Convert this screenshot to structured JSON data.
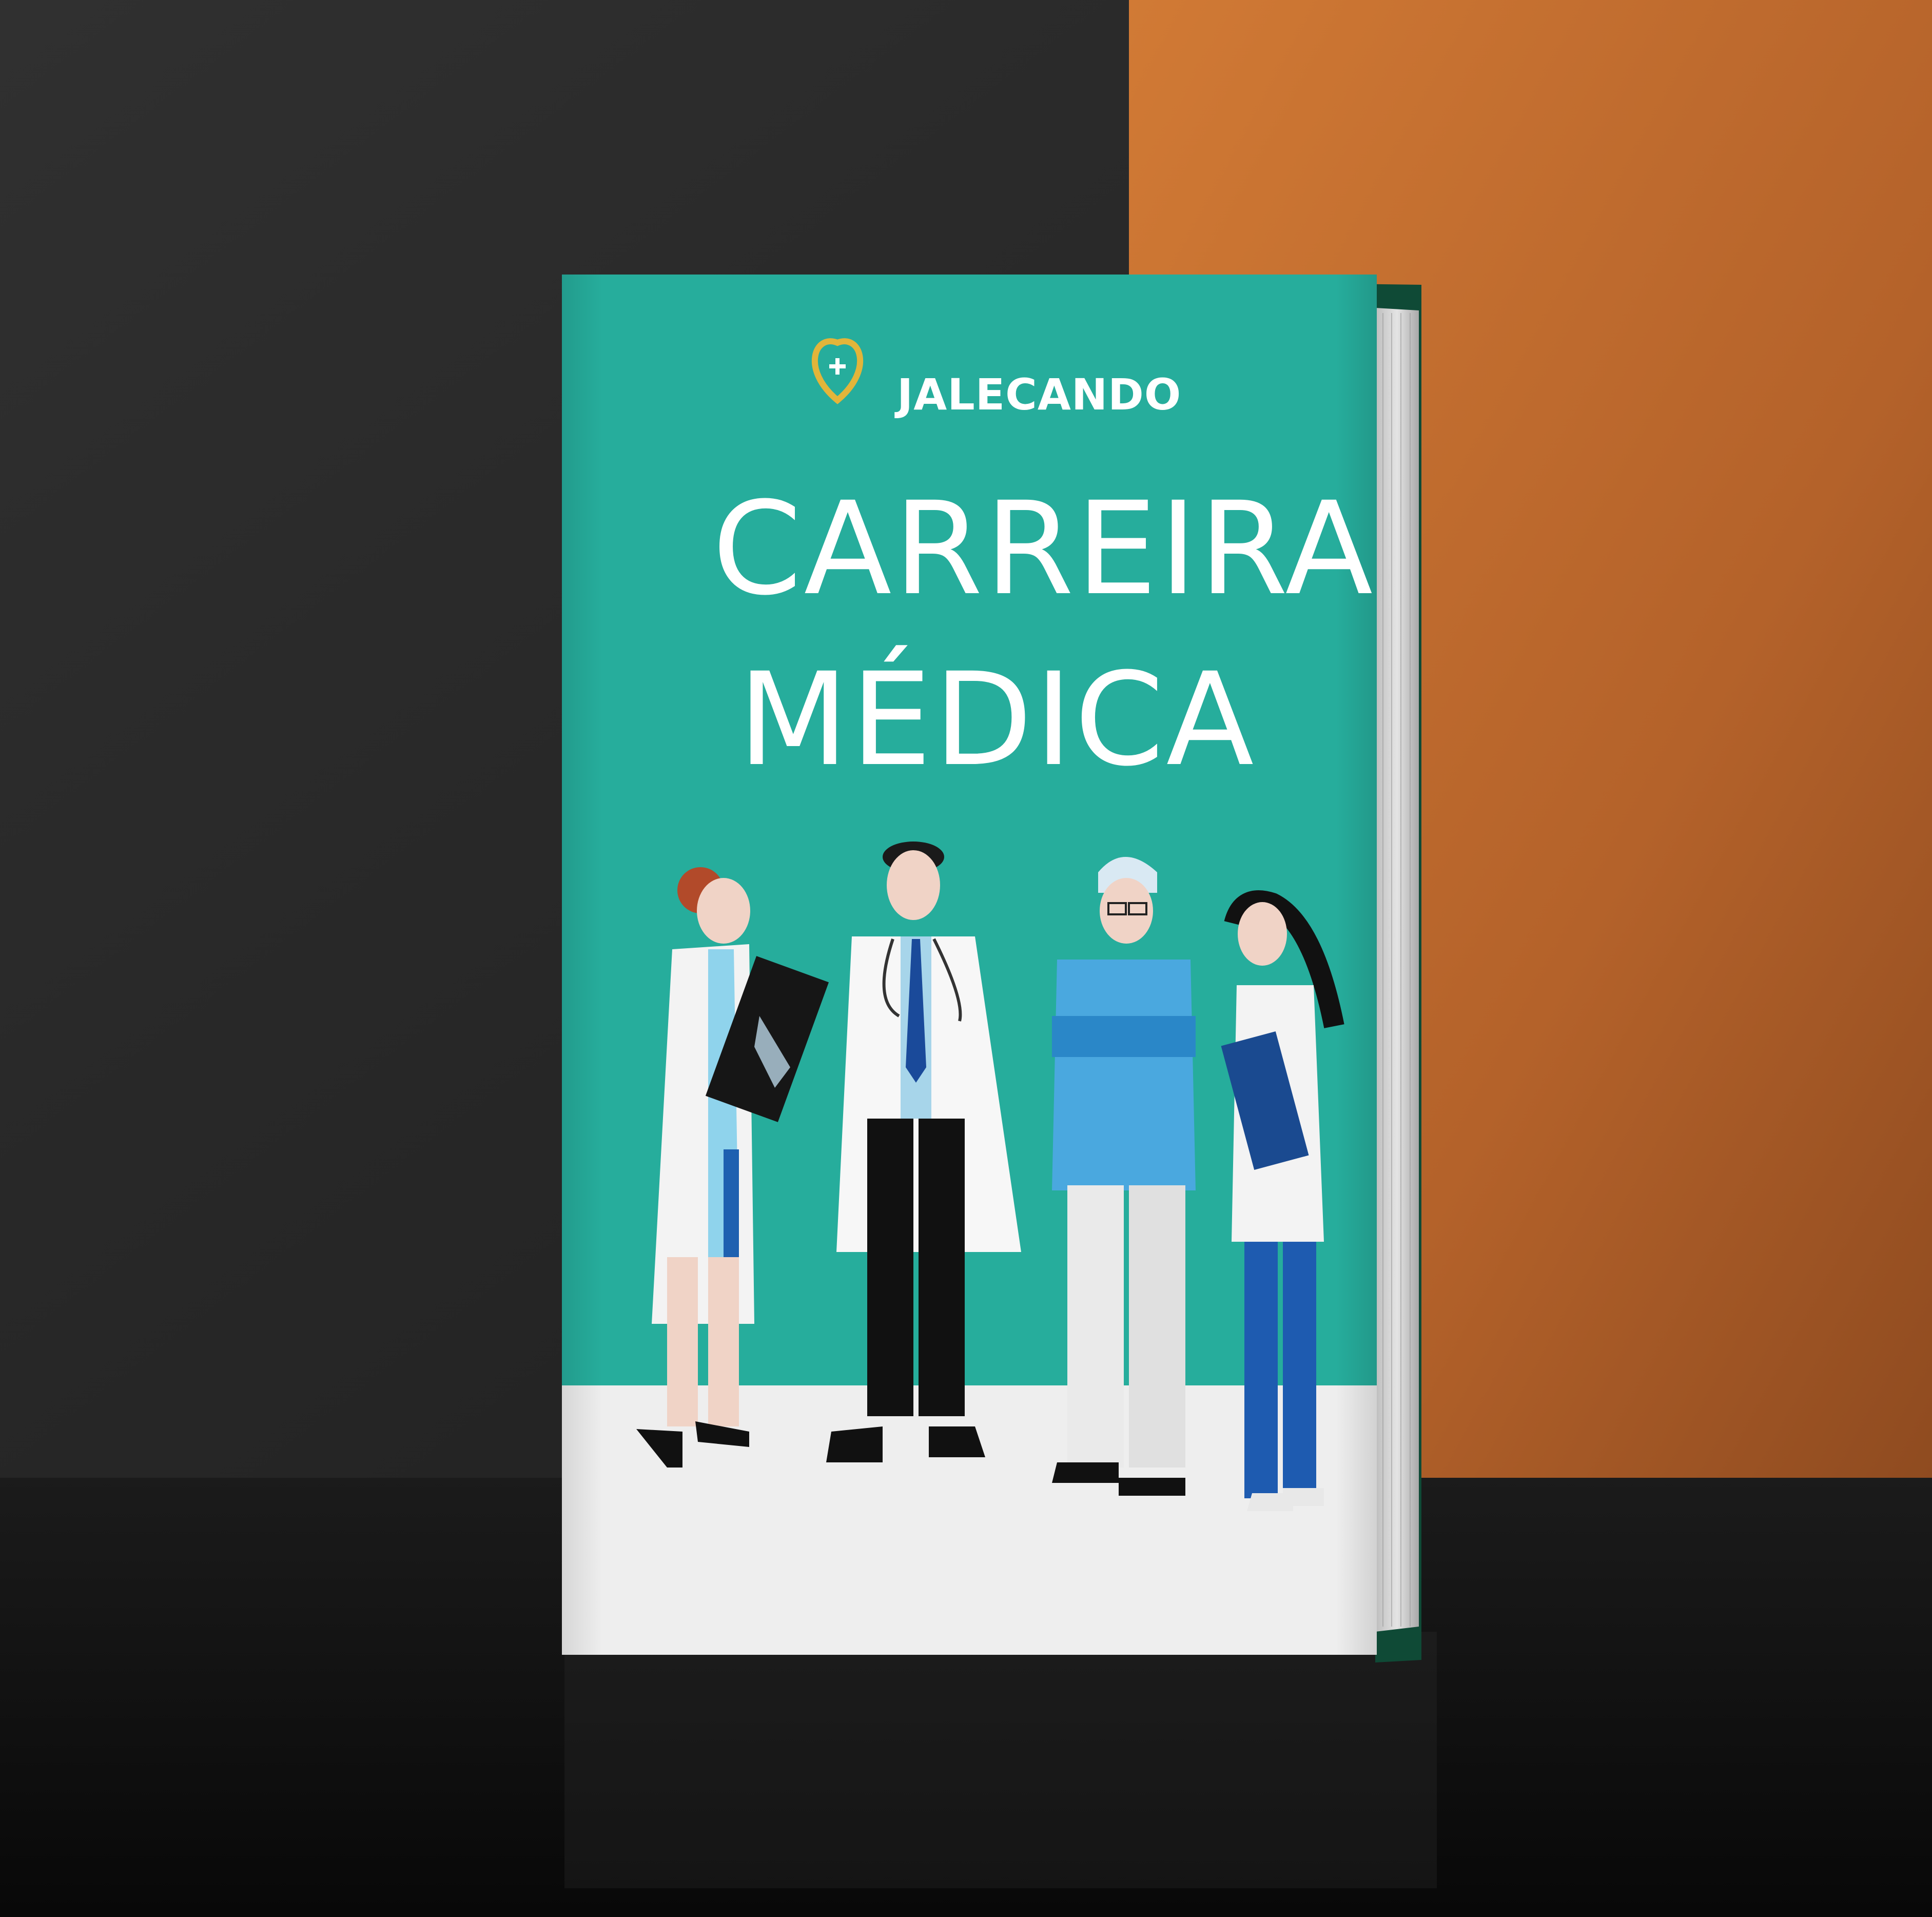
{
  "book": {
    "brand": "JALECANDO",
    "title_line1": "CARREIRA",
    "title_line2": "MÉDICA"
  },
  "colors": {
    "cover_teal": "#26ad9c",
    "cover_floor": "#eeeeee",
    "wall_dark": "#262626",
    "wall_orange": "#c5702f",
    "floor_dark": "#121212",
    "logo_gold": "#e2b53a",
    "spine_green": "#0f4a36"
  },
  "illustration": {
    "figures": [
      "female-doctor-with-xray",
      "male-doctor-with-tie",
      "surgeon-arms-crossed",
      "nurse-with-clipboard"
    ]
  }
}
